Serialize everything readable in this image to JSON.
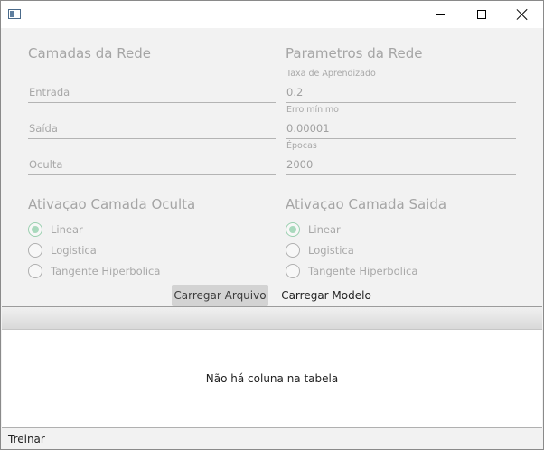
{
  "window": {
    "icon": "app-window-icon",
    "controls": {
      "minimize": "minimize-icon",
      "maximize": "maximize-icon",
      "close": "close-icon"
    }
  },
  "layers": {
    "title": "Camadas da Rede",
    "input_placeholder": "Entrada",
    "output_placeholder": "Saída",
    "hidden_placeholder": "Oculta"
  },
  "params": {
    "title": "Parametros da Rede",
    "learning_rate": {
      "label": "Taxa de Aprendizado",
      "value": "0.2"
    },
    "min_error": {
      "label": "Erro mínimo",
      "value": "0.00001"
    },
    "epochs": {
      "label": "Épocas",
      "value": "2000"
    }
  },
  "hidden_activation": {
    "title": "Ativaçao Camada Oculta",
    "options": [
      "Linear",
      "Logistica",
      "Tangente Hiperbolica"
    ],
    "selected": "Linear"
  },
  "output_activation": {
    "title": "Ativaçao Camada Saida",
    "options": [
      "Linear",
      "Logistica",
      "Tangente Hiperbolica"
    ],
    "selected": "Linear"
  },
  "buttons": {
    "load_file": "Carregar Arquivo",
    "load_model": "Carregar Modelo"
  },
  "table": {
    "placeholder": "Não há coluna na tabela"
  },
  "status": {
    "train": "Treinar"
  },
  "colors": {
    "radio_selected": "#a9d9bd",
    "panel_bg": "#f2f2f2",
    "button_bg": "#d3d3d3"
  }
}
